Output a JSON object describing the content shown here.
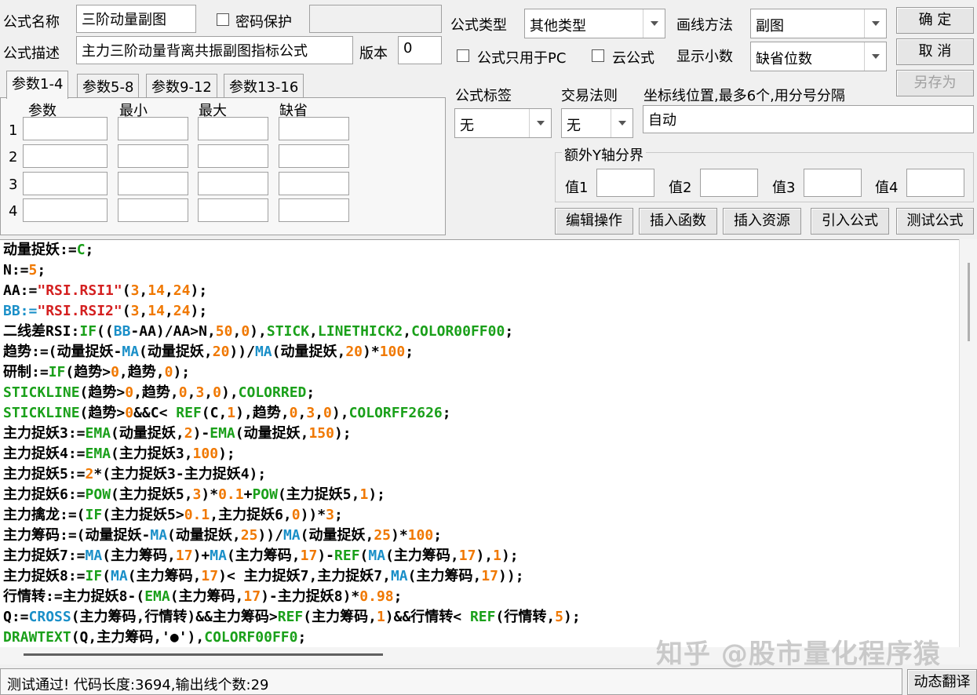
{
  "header": {
    "name_label": "公式名称",
    "name_value": "三阶动量副图",
    "password_label": "密码保护",
    "desc_label": "公式描述",
    "desc_value": "主力三阶动量背离共振副图指标公式",
    "version_label": "版本",
    "version_value": "0",
    "type_label": "公式类型",
    "type_value": "其他类型",
    "draw_label": "画线方法",
    "draw_value": "副图",
    "pc_only_label": "公式只用于PC",
    "cloud_label": "云公式",
    "decimal_label": "显示小数",
    "decimal_value": "缺省位数"
  },
  "buttons": {
    "ok": "确 定",
    "cancel": "取 消",
    "save_as": "另存为",
    "edit": "编辑操作",
    "insert_func": "插入函数",
    "insert_res": "插入资源",
    "import": "引入公式",
    "test": "测试公式",
    "translate": "动态翻译"
  },
  "tabs": [
    "参数1-4",
    "参数5-8",
    "参数9-12",
    "参数13-16"
  ],
  "params": {
    "headers": [
      "参数",
      "最小",
      "最大",
      "缺省"
    ],
    "rows": [
      "1",
      "2",
      "3",
      "4"
    ]
  },
  "tag": {
    "label": "公式标签",
    "value": "无"
  },
  "rule": {
    "label": "交易法则",
    "value": "无"
  },
  "coord": {
    "label": "坐标线位置,最多6个,用分号分隔",
    "value": "自动"
  },
  "yaxis": {
    "legend": "额外Y轴分界",
    "labels": [
      "值1",
      "值2",
      "值3",
      "值4"
    ]
  },
  "code": [
    [
      [
        "动量捉妖:=",
        ""
      ],
      [
        "C",
        "k"
      ],
      [
        ";",
        ""
      ]
    ],
    [
      [
        "N:=",
        ""
      ],
      [
        "5",
        "n"
      ],
      [
        ";",
        ""
      ]
    ],
    [
      [
        "AA:=",
        ""
      ],
      [
        "\"RSI.RSI1\"",
        "s"
      ],
      [
        "(",
        ""
      ],
      [
        "3",
        "n"
      ],
      [
        ",",
        ""
      ],
      [
        "14",
        "n"
      ],
      [
        ",",
        ""
      ],
      [
        "24",
        "n"
      ],
      [
        ");",
        ""
      ]
    ],
    [
      [
        "BB:=",
        "b"
      ],
      [
        "\"RSI.RSI2\"",
        "s"
      ],
      [
        "(",
        ""
      ],
      [
        "3",
        "n"
      ],
      [
        ",",
        ""
      ],
      [
        "14",
        "n"
      ],
      [
        ",",
        ""
      ],
      [
        "24",
        "n"
      ],
      [
        ");",
        ""
      ]
    ],
    [
      [
        "二线差RSI:",
        ""
      ],
      [
        "IF",
        "k"
      ],
      [
        "((",
        ""
      ],
      [
        "BB",
        "b"
      ],
      [
        "-AA)/AA>N,",
        ""
      ],
      [
        "50",
        "n"
      ],
      [
        ",",
        ""
      ],
      [
        "0",
        "n"
      ],
      [
        "),",
        ""
      ],
      [
        "STICK",
        "k"
      ],
      [
        ",",
        ""
      ],
      [
        "LINETHICK2",
        "k"
      ],
      [
        ",",
        ""
      ],
      [
        "COLOR00FF00",
        "k"
      ],
      [
        ";",
        ""
      ]
    ],
    [
      [
        "趋势:=(动量捉妖-",
        ""
      ],
      [
        "MA",
        "f"
      ],
      [
        "(动量捉妖,",
        ""
      ],
      [
        "20",
        "n"
      ],
      [
        "))/",
        ""
      ],
      [
        "MA",
        "f"
      ],
      [
        "(动量捉妖,",
        ""
      ],
      [
        "20",
        "n"
      ],
      [
        ")*",
        ""
      ],
      [
        "100",
        "n"
      ],
      [
        ";",
        ""
      ]
    ],
    [
      [
        "研制:=",
        ""
      ],
      [
        "IF",
        "k"
      ],
      [
        "(趋势>",
        ""
      ],
      [
        "0",
        "n"
      ],
      [
        ",趋势,",
        ""
      ],
      [
        "0",
        "n"
      ],
      [
        ");",
        ""
      ]
    ],
    [
      [
        "STICKLINE",
        "k"
      ],
      [
        "(趋势>",
        ""
      ],
      [
        "0",
        "n"
      ],
      [
        ",趋势,",
        ""
      ],
      [
        "0",
        "n"
      ],
      [
        ",",
        ""
      ],
      [
        "3",
        "n"
      ],
      [
        ",",
        ""
      ],
      [
        "0",
        "n"
      ],
      [
        "),",
        ""
      ],
      [
        "COLORRED",
        "k"
      ],
      [
        ";",
        ""
      ]
    ],
    [
      [
        "STICKLINE",
        "k"
      ],
      [
        "(趋势>",
        ""
      ],
      [
        "0",
        "n"
      ],
      [
        "&&C< ",
        ""
      ],
      [
        "REF",
        "k"
      ],
      [
        "(C,",
        ""
      ],
      [
        "1",
        "n"
      ],
      [
        "),趋势,",
        ""
      ],
      [
        "0",
        "n"
      ],
      [
        ",",
        ""
      ],
      [
        "3",
        "n"
      ],
      [
        ",",
        ""
      ],
      [
        "0",
        "n"
      ],
      [
        "),",
        ""
      ],
      [
        "COLORFF2626",
        "k"
      ],
      [
        ";",
        ""
      ]
    ],
    [
      [
        "主力捉妖3:=",
        ""
      ],
      [
        "EMA",
        "k"
      ],
      [
        "(动量捉妖,",
        ""
      ],
      [
        "2",
        "n"
      ],
      [
        ")-",
        ""
      ],
      [
        "EMA",
        "k"
      ],
      [
        "(动量捉妖,",
        ""
      ],
      [
        "150",
        "n"
      ],
      [
        ");",
        ""
      ]
    ],
    [
      [
        "主力捉妖4:=",
        ""
      ],
      [
        "EMA",
        "k"
      ],
      [
        "(主力捉妖3,",
        ""
      ],
      [
        "100",
        "n"
      ],
      [
        ");",
        ""
      ]
    ],
    [
      [
        "主力捉妖5:=",
        ""
      ],
      [
        "2",
        "n"
      ],
      [
        "*(主力捉妖3-主力捉妖4);",
        ""
      ]
    ],
    [
      [
        "主力捉妖6:=",
        ""
      ],
      [
        "POW",
        "k"
      ],
      [
        "(主力捉妖5,",
        ""
      ],
      [
        "3",
        "n"
      ],
      [
        ")*",
        ""
      ],
      [
        "0.1",
        "n"
      ],
      [
        "+",
        ""
      ],
      [
        "POW",
        "k"
      ],
      [
        "(主力捉妖5,",
        ""
      ],
      [
        "1",
        "n"
      ],
      [
        ");",
        ""
      ]
    ],
    [
      [
        "主力擒龙:=(",
        ""
      ],
      [
        "IF",
        "k"
      ],
      [
        "(主力捉妖5>",
        ""
      ],
      [
        "0.1",
        "n"
      ],
      [
        ",主力捉妖6,",
        ""
      ],
      [
        "0",
        "n"
      ],
      [
        "))*",
        ""
      ],
      [
        "3",
        "n"
      ],
      [
        ";",
        ""
      ]
    ],
    [
      [
        "主力筹码:=(动量捉妖-",
        ""
      ],
      [
        "MA",
        "f"
      ],
      [
        "(动量捉妖,",
        ""
      ],
      [
        "25",
        "n"
      ],
      [
        "))/",
        ""
      ],
      [
        "MA",
        "f"
      ],
      [
        "(动量捉妖,",
        ""
      ],
      [
        "25",
        "n"
      ],
      [
        ")*",
        ""
      ],
      [
        "100",
        "n"
      ],
      [
        ";",
        ""
      ]
    ],
    [
      [
        "主力捉妖7:=",
        ""
      ],
      [
        "MA",
        "f"
      ],
      [
        "(主力筹码,",
        ""
      ],
      [
        "17",
        "n"
      ],
      [
        ")+",
        ""
      ],
      [
        "MA",
        "f"
      ],
      [
        "(主力筹码,",
        ""
      ],
      [
        "17",
        "n"
      ],
      [
        ")-",
        ""
      ],
      [
        "REF",
        "k"
      ],
      [
        "(",
        ""
      ],
      [
        "MA",
        "f"
      ],
      [
        "(主力筹码,",
        ""
      ],
      [
        "17",
        "n"
      ],
      [
        "),",
        ""
      ],
      [
        "1",
        "n"
      ],
      [
        ");",
        ""
      ]
    ],
    [
      [
        "主力捉妖8:=",
        ""
      ],
      [
        "IF",
        "k"
      ],
      [
        "(",
        ""
      ],
      [
        "MA",
        "f"
      ],
      [
        "(主力筹码,",
        ""
      ],
      [
        "17",
        "n"
      ],
      [
        ")< 主力捉妖7,主力捉妖7,",
        ""
      ],
      [
        "MA",
        "f"
      ],
      [
        "(主力筹码,",
        ""
      ],
      [
        "17",
        "n"
      ],
      [
        "));",
        ""
      ]
    ],
    [
      [
        "行情转:=主力捉妖8-(",
        ""
      ],
      [
        "EMA",
        "k"
      ],
      [
        "(主力筹码,",
        ""
      ],
      [
        "17",
        "n"
      ],
      [
        ")-主力捉妖8)*",
        ""
      ],
      [
        "0.98",
        "n"
      ],
      [
        ";",
        ""
      ]
    ],
    [
      [
        "Q:=",
        ""
      ],
      [
        "CROSS",
        "f"
      ],
      [
        "(主力筹码,行情转)&&主力筹码>",
        ""
      ],
      [
        "REF",
        "k"
      ],
      [
        "(主力筹码,",
        ""
      ],
      [
        "1",
        "n"
      ],
      [
        ")&&行情转< ",
        ""
      ],
      [
        "REF",
        "k"
      ],
      [
        "(行情转,",
        ""
      ],
      [
        "5",
        "n"
      ],
      [
        ");",
        ""
      ]
    ],
    [
      [
        "DRAWTEXT",
        "k"
      ],
      [
        "(Q,主力筹码,'●'),",
        ""
      ],
      [
        "COLORF00FF0",
        "k"
      ],
      [
        ";",
        ""
      ]
    ]
  ],
  "status": "测试通过! 代码长度:3694,输出线个数:29",
  "watermark": "知乎 @股市量化程序猿"
}
